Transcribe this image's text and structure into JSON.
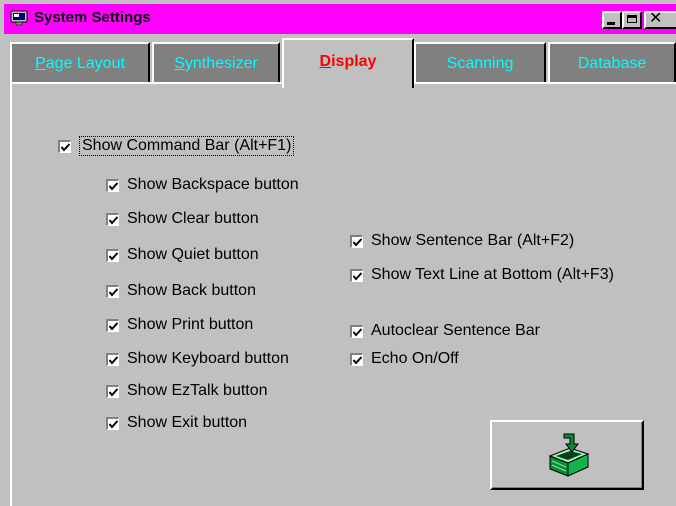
{
  "window": {
    "title": "System Settings"
  },
  "tabs": [
    {
      "label": "Page Layout",
      "accel": "P",
      "rest": "age Layout",
      "active": false
    },
    {
      "label": "Synthesizer",
      "accel": "S",
      "rest": "ynthesizer",
      "active": false
    },
    {
      "label": "Display",
      "accel": "D",
      "rest": "isplay",
      "active": true
    },
    {
      "label": "Scanning",
      "active": false
    },
    {
      "label": "Database",
      "active": false
    }
  ],
  "display": {
    "command_bar": {
      "label": "Show Command Bar (Alt+F1)",
      "checked": true
    },
    "buttons": [
      {
        "label": "Show Backspace button",
        "checked": true
      },
      {
        "label": "Show Clear button",
        "checked": true
      },
      {
        "label": "Show Quiet button",
        "checked": true
      },
      {
        "label": "Show Back button",
        "checked": true
      },
      {
        "label": "Show Print button",
        "checked": true
      },
      {
        "label": "Show Keyboard button",
        "checked": true
      },
      {
        "label": "Show EzTalk button",
        "checked": true
      },
      {
        "label": "Show Exit button",
        "checked": true
      }
    ],
    "right": [
      {
        "label": "Show Sentence Bar (Alt+F2)",
        "checked": true
      },
      {
        "label": "Show Text Line at Bottom (Alt+F3)",
        "checked": true
      },
      {
        "label": "Autoclear Sentence Bar",
        "checked": true
      },
      {
        "label": "Echo On/Off",
        "checked": true
      }
    ]
  },
  "colors": {
    "titlebar": "#ff00ff",
    "active_tab_text": "#ff0000",
    "inactive_tab_text": "#00ffff",
    "inactive_tab_bg": "#808080",
    "face": "#c0c0c0"
  },
  "icons": {
    "title": "system-settings-icon",
    "save": "save-to-box-icon"
  }
}
